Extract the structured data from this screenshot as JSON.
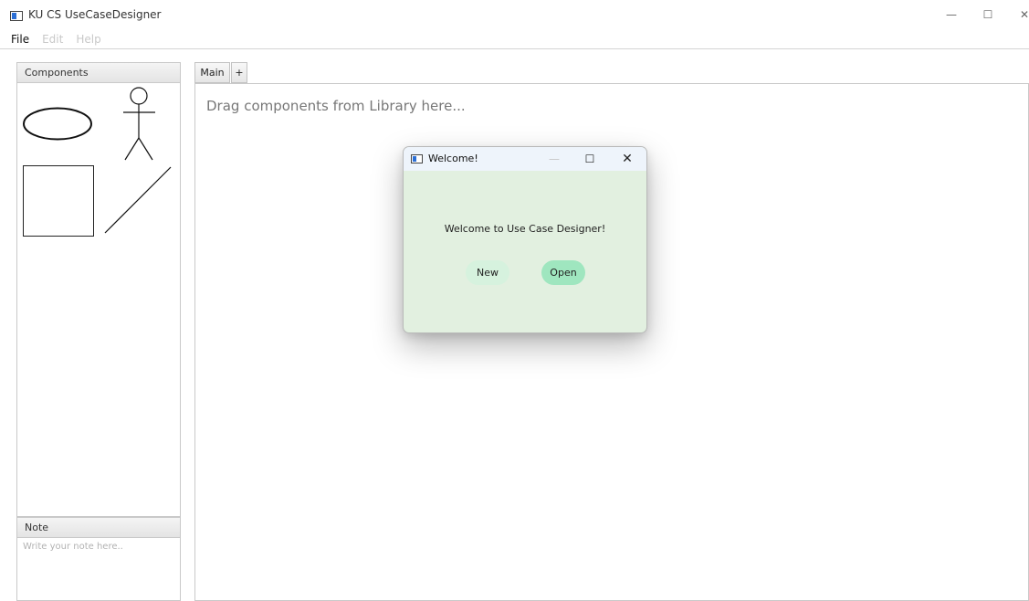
{
  "window": {
    "title": "KU CS UseCaseDesigner",
    "icon": "app-window-icon",
    "controls": {
      "minimize": "—",
      "maximize": "☐",
      "close": "✕"
    }
  },
  "menu": {
    "items": [
      {
        "label": "File",
        "enabled": true
      },
      {
        "label": "Edit",
        "enabled": false
      },
      {
        "label": "Help",
        "enabled": false
      }
    ]
  },
  "components_panel": {
    "title": "Components",
    "items": [
      {
        "name": "use-case-ellipse-icon"
      },
      {
        "name": "actor-stick-figure-icon"
      },
      {
        "name": "system-boundary-rectangle-icon"
      },
      {
        "name": "association-line-icon"
      }
    ]
  },
  "note_panel": {
    "title": "Note",
    "placeholder": "Write your note here.."
  },
  "tabs": {
    "items": [
      {
        "label": "Main"
      },
      {
        "label": "+"
      }
    ]
  },
  "canvas": {
    "hint": "Drag components from Library here..."
  },
  "dialog": {
    "title": "Welcome!",
    "controls": {
      "minimize": "—",
      "maximize": "☐",
      "close": "✕"
    },
    "message": "Welcome to Use Case Designer!",
    "buttons": {
      "new": "New",
      "open": "Open"
    }
  },
  "colors": {
    "dialog_background": "#e2f0e0",
    "new_button": "#d6f2de",
    "open_button": "#9fe6bf",
    "hint_text": "#777777",
    "disabled_menu": "#c8c8c8"
  }
}
